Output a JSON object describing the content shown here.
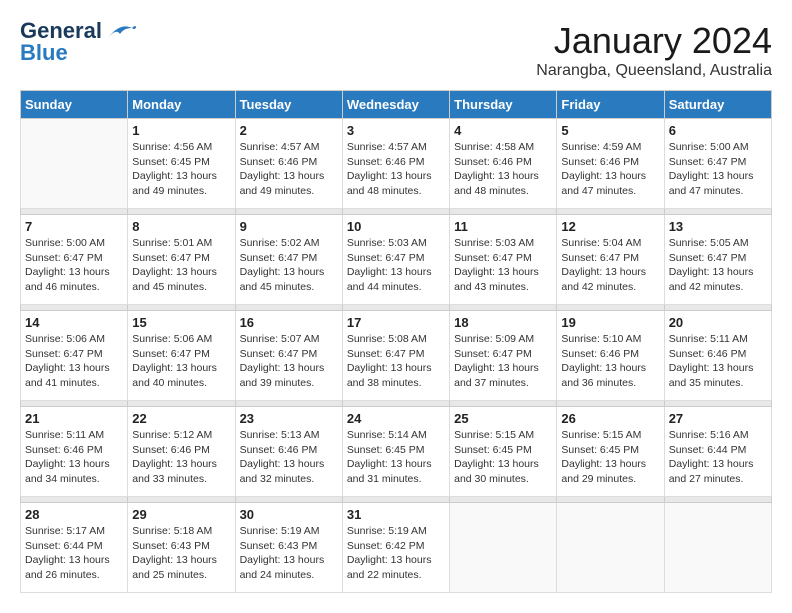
{
  "logo": {
    "line1": "General",
    "line2": "Blue"
  },
  "title": "January 2024",
  "subtitle": "Narangba, Queensland, Australia",
  "weekdays": [
    "Sunday",
    "Monday",
    "Tuesday",
    "Wednesday",
    "Thursday",
    "Friday",
    "Saturday"
  ],
  "weeks": [
    [
      {
        "day": "",
        "info": ""
      },
      {
        "day": "1",
        "info": "Sunrise: 4:56 AM\nSunset: 6:45 PM\nDaylight: 13 hours\nand 49 minutes."
      },
      {
        "day": "2",
        "info": "Sunrise: 4:57 AM\nSunset: 6:46 PM\nDaylight: 13 hours\nand 49 minutes."
      },
      {
        "day": "3",
        "info": "Sunrise: 4:57 AM\nSunset: 6:46 PM\nDaylight: 13 hours\nand 48 minutes."
      },
      {
        "day": "4",
        "info": "Sunrise: 4:58 AM\nSunset: 6:46 PM\nDaylight: 13 hours\nand 48 minutes."
      },
      {
        "day": "5",
        "info": "Sunrise: 4:59 AM\nSunset: 6:46 PM\nDaylight: 13 hours\nand 47 minutes."
      },
      {
        "day": "6",
        "info": "Sunrise: 5:00 AM\nSunset: 6:47 PM\nDaylight: 13 hours\nand 47 minutes."
      }
    ],
    [
      {
        "day": "7",
        "info": "Sunrise: 5:00 AM\nSunset: 6:47 PM\nDaylight: 13 hours\nand 46 minutes."
      },
      {
        "day": "8",
        "info": "Sunrise: 5:01 AM\nSunset: 6:47 PM\nDaylight: 13 hours\nand 45 minutes."
      },
      {
        "day": "9",
        "info": "Sunrise: 5:02 AM\nSunset: 6:47 PM\nDaylight: 13 hours\nand 45 minutes."
      },
      {
        "day": "10",
        "info": "Sunrise: 5:03 AM\nSunset: 6:47 PM\nDaylight: 13 hours\nand 44 minutes."
      },
      {
        "day": "11",
        "info": "Sunrise: 5:03 AM\nSunset: 6:47 PM\nDaylight: 13 hours\nand 43 minutes."
      },
      {
        "day": "12",
        "info": "Sunrise: 5:04 AM\nSunset: 6:47 PM\nDaylight: 13 hours\nand 42 minutes."
      },
      {
        "day": "13",
        "info": "Sunrise: 5:05 AM\nSunset: 6:47 PM\nDaylight: 13 hours\nand 42 minutes."
      }
    ],
    [
      {
        "day": "14",
        "info": "Sunrise: 5:06 AM\nSunset: 6:47 PM\nDaylight: 13 hours\nand 41 minutes."
      },
      {
        "day": "15",
        "info": "Sunrise: 5:06 AM\nSunset: 6:47 PM\nDaylight: 13 hours\nand 40 minutes."
      },
      {
        "day": "16",
        "info": "Sunrise: 5:07 AM\nSunset: 6:47 PM\nDaylight: 13 hours\nand 39 minutes."
      },
      {
        "day": "17",
        "info": "Sunrise: 5:08 AM\nSunset: 6:47 PM\nDaylight: 13 hours\nand 38 minutes."
      },
      {
        "day": "18",
        "info": "Sunrise: 5:09 AM\nSunset: 6:47 PM\nDaylight: 13 hours\nand 37 minutes."
      },
      {
        "day": "19",
        "info": "Sunrise: 5:10 AM\nSunset: 6:46 PM\nDaylight: 13 hours\nand 36 minutes."
      },
      {
        "day": "20",
        "info": "Sunrise: 5:11 AM\nSunset: 6:46 PM\nDaylight: 13 hours\nand 35 minutes."
      }
    ],
    [
      {
        "day": "21",
        "info": "Sunrise: 5:11 AM\nSunset: 6:46 PM\nDaylight: 13 hours\nand 34 minutes."
      },
      {
        "day": "22",
        "info": "Sunrise: 5:12 AM\nSunset: 6:46 PM\nDaylight: 13 hours\nand 33 minutes."
      },
      {
        "day": "23",
        "info": "Sunrise: 5:13 AM\nSunset: 6:46 PM\nDaylight: 13 hours\nand 32 minutes."
      },
      {
        "day": "24",
        "info": "Sunrise: 5:14 AM\nSunset: 6:45 PM\nDaylight: 13 hours\nand 31 minutes."
      },
      {
        "day": "25",
        "info": "Sunrise: 5:15 AM\nSunset: 6:45 PM\nDaylight: 13 hours\nand 30 minutes."
      },
      {
        "day": "26",
        "info": "Sunrise: 5:15 AM\nSunset: 6:45 PM\nDaylight: 13 hours\nand 29 minutes."
      },
      {
        "day": "27",
        "info": "Sunrise: 5:16 AM\nSunset: 6:44 PM\nDaylight: 13 hours\nand 27 minutes."
      }
    ],
    [
      {
        "day": "28",
        "info": "Sunrise: 5:17 AM\nSunset: 6:44 PM\nDaylight: 13 hours\nand 26 minutes."
      },
      {
        "day": "29",
        "info": "Sunrise: 5:18 AM\nSunset: 6:43 PM\nDaylight: 13 hours\nand 25 minutes."
      },
      {
        "day": "30",
        "info": "Sunrise: 5:19 AM\nSunset: 6:43 PM\nDaylight: 13 hours\nand 24 minutes."
      },
      {
        "day": "31",
        "info": "Sunrise: 5:19 AM\nSunset: 6:42 PM\nDaylight: 13 hours\nand 22 minutes."
      },
      {
        "day": "",
        "info": ""
      },
      {
        "day": "",
        "info": ""
      },
      {
        "day": "",
        "info": ""
      }
    ]
  ]
}
